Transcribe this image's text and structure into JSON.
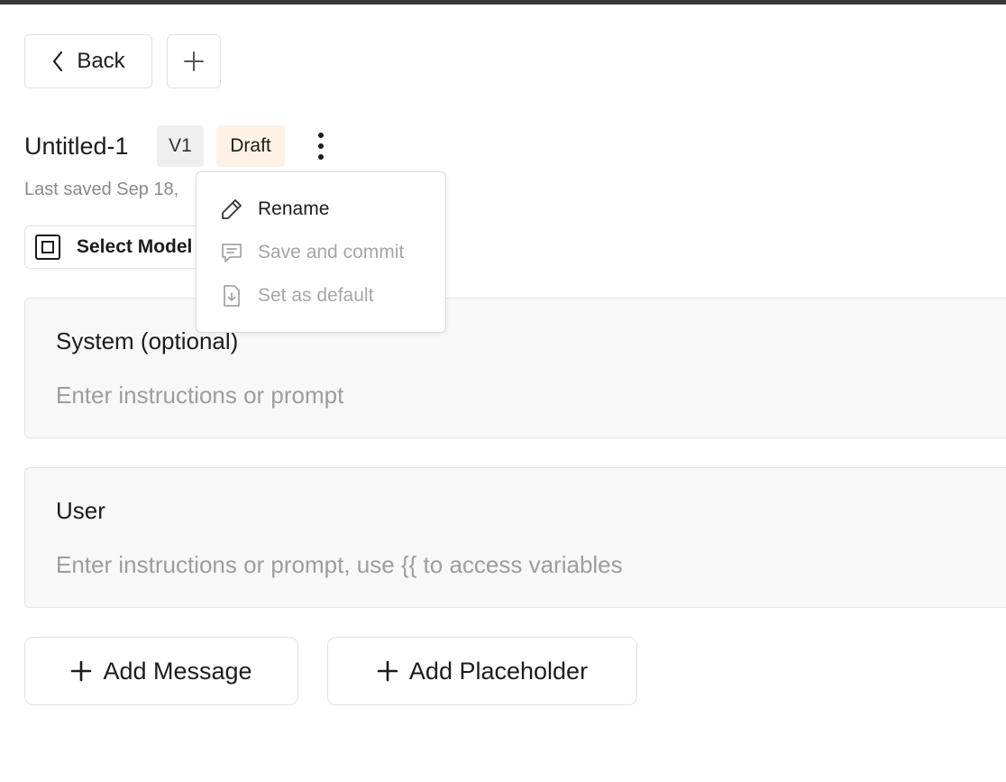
{
  "toolbar": {
    "back_label": "Back",
    "add_icon": "plus-icon"
  },
  "prompt": {
    "title": "Untitled-1",
    "version": "V1",
    "status": "Draft",
    "last_saved": "Last saved Sep 18,"
  },
  "model": {
    "label": "Select Model",
    "icon": "model-icon"
  },
  "menu": {
    "items": [
      {
        "label": "Rename",
        "icon": "pencil-icon",
        "enabled": true
      },
      {
        "label": "Save and commit",
        "icon": "comment-icon",
        "enabled": false
      },
      {
        "label": "Set as default",
        "icon": "file-download-icon",
        "enabled": false
      }
    ]
  },
  "messages": [
    {
      "label": "System (optional)",
      "placeholder": "Enter instructions or prompt"
    },
    {
      "label": "User",
      "placeholder": "Enter instructions or prompt, use {{ to access variables"
    }
  ],
  "actions": {
    "add_message": "Add Message",
    "add_placeholder": "Add Placeholder"
  },
  "colors": {
    "draft_badge_bg": "#fdf2e3",
    "version_badge_bg": "#efefef",
    "card_bg": "#f8f8f8",
    "topbar": "#3a3a3a"
  }
}
